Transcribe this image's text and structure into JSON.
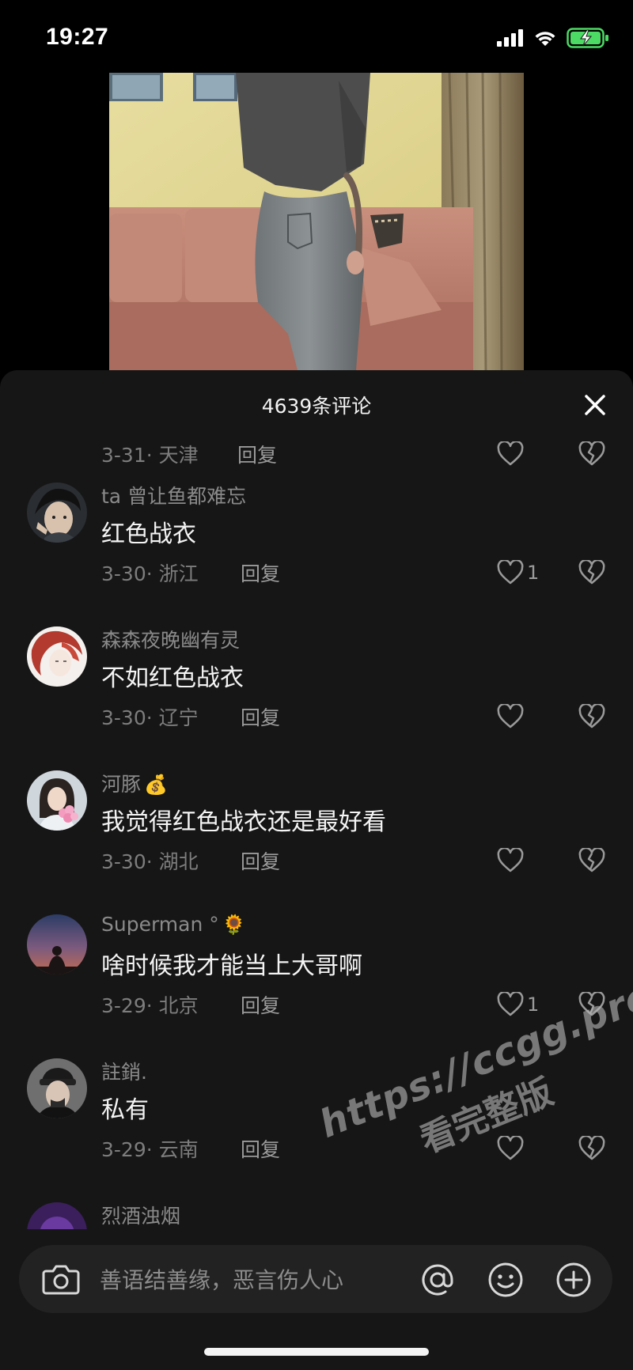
{
  "status_bar": {
    "time": "19:27"
  },
  "comments_panel": {
    "title": "4639条评论",
    "close_icon": "close-icon"
  },
  "partial_top_meta": {
    "date_location": "3-31· 天津",
    "reply_label": "回复"
  },
  "comments": [
    {
      "username": "ta 曾让鱼都难忘",
      "badge": "",
      "text": "红色战衣",
      "date_location": "3-30· 浙江",
      "reply_label": "回复",
      "likes": "1"
    },
    {
      "username": "森森夜晚幽有灵",
      "badge": "",
      "text": "不如红色战衣",
      "date_location": "3-30· 辽宁",
      "reply_label": "回复",
      "likes": ""
    },
    {
      "username": "河豚",
      "badge": "💰",
      "text": "我觉得红色战衣还是最好看",
      "date_location": "3-30· 湖北",
      "reply_label": "回复",
      "likes": ""
    },
    {
      "username": "Superman °",
      "badge": "🌻",
      "text": "啥时候我才能当上大哥啊",
      "date_location": "3-29· 北京",
      "reply_label": "回复",
      "likes": "1"
    },
    {
      "username": "註銷.",
      "badge": "",
      "text": "私有",
      "date_location": "3-29· 云南",
      "reply_label": "回复",
      "likes": ""
    }
  ],
  "partial_bottom_username": "烈酒浊烟",
  "watermark": {
    "line1": "https://ccgg.pro",
    "line2": "看完整版"
  },
  "input_bar": {
    "placeholder": "善语结善缘，恶言伤人心",
    "icons": [
      "camera-icon",
      "at-icon",
      "emoji-icon",
      "plus-icon"
    ]
  },
  "colors": {
    "sheet_background": "#161616",
    "input_background": "#222222",
    "battery_green": "#4cd964"
  }
}
